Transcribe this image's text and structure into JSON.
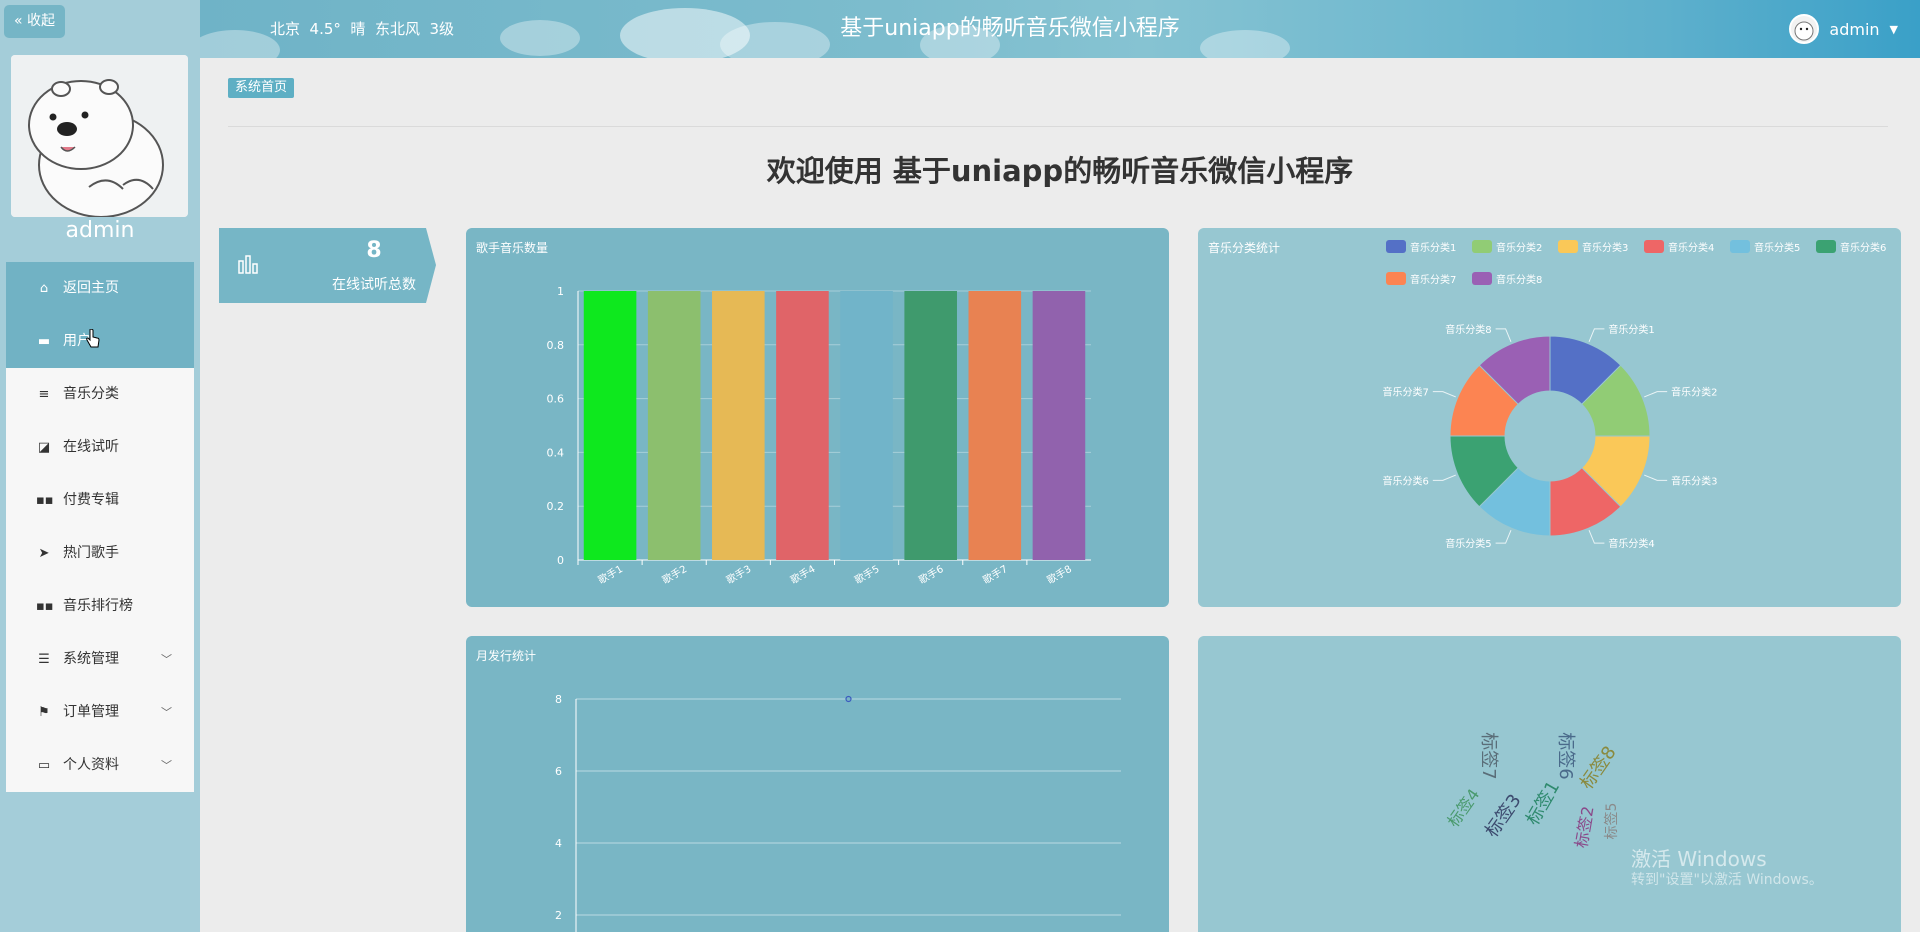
{
  "sidebar": {
    "collapse_label": "« 收起",
    "username": "admin",
    "menu": [
      {
        "label": "返回主页",
        "icon": "home-icon"
      },
      {
        "label": "用户",
        "icon": "monitor-icon"
      },
      {
        "label": "音乐分类",
        "icon": "list-icon"
      },
      {
        "label": "在线试听",
        "icon": "chart-icon"
      },
      {
        "label": "付费专辑",
        "icon": "grid-icon"
      },
      {
        "label": "热门歌手",
        "icon": "send-icon"
      },
      {
        "label": "音乐排行榜",
        "icon": "grid-icon"
      },
      {
        "label": "系统管理",
        "icon": "sliders-icon"
      },
      {
        "label": "订单管理",
        "icon": "flag-icon"
      },
      {
        "label": "个人资料",
        "icon": "card-icon"
      }
    ]
  },
  "header": {
    "weather": "北京  4.5°  晴  东北风  3级",
    "title": "基于uniapp的畅听音乐微信小程序",
    "username": "admin"
  },
  "breadcrumb": "系统首页",
  "welcome": "欢迎使用 基于uniapp的畅听音乐微信小程序",
  "stat": {
    "value": "8",
    "label": "在线试听总数"
  },
  "chart_data": [
    {
      "type": "bar",
      "title": "歌手音乐数量",
      "categories": [
        "歌手1",
        "歌手2",
        "歌手3",
        "歌手4",
        "歌手5",
        "歌手6",
        "歌手7",
        "歌手8"
      ],
      "values": [
        1,
        1,
        1,
        1,
        1,
        1,
        1,
        1
      ],
      "colors": [
        "#0ee81e",
        "#8cbf6e",
        "#e6b955",
        "#e06468",
        "#71b4c9",
        "#3f9a6d",
        "#e88252",
        "#9162ad"
      ],
      "yticks": [
        "0",
        "0.2",
        "0.4",
        "0.6",
        "0.8",
        "1"
      ],
      "ylim": [
        0,
        1
      ]
    },
    {
      "type": "pie",
      "title": "音乐分类统计",
      "labels": [
        "音乐分类1",
        "音乐分类2",
        "音乐分类3",
        "音乐分类4",
        "音乐分类5",
        "音乐分类6",
        "音乐分类7",
        "音乐分类8"
      ],
      "values": [
        1,
        1,
        1,
        1,
        1,
        1,
        1,
        1
      ],
      "colors": [
        "#5470c6",
        "#91cc75",
        "#fac858",
        "#ee6666",
        "#73c0de",
        "#3ba272",
        "#fc8452",
        "#9a60b4"
      ],
      "legend": "top-right"
    },
    {
      "type": "line",
      "title": "月发行统计",
      "yticks": [
        "2",
        "4",
        "6",
        "8"
      ],
      "points": [
        {
          "x": "",
          "y": 8
        }
      ]
    }
  ],
  "tags": {
    "words": [
      "标签7",
      "标签4",
      "标签3",
      "标签6",
      "标签1",
      "标签8",
      "标签2",
      "标签5"
    ],
    "colors": [
      "#5a6d78",
      "#4a9a6e",
      "#3c4a6e",
      "#4a6a8a",
      "#2f8a6e",
      "#8a8a3e",
      "#8a4a8a",
      "#8a8a8a"
    ]
  },
  "watermark": {
    "line1": "激活 Windows",
    "line2": "转到\"设置\"以激活 Windows。"
  }
}
